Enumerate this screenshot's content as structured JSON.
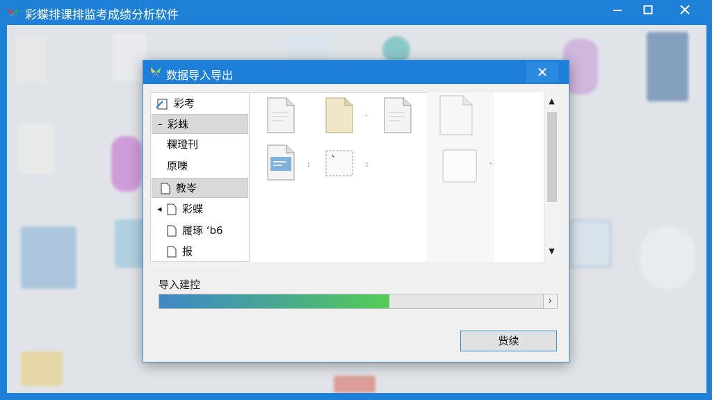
{
  "app": {
    "title": "彩蝶排课排监考成绩分析软件",
    "window_controls": {
      "minimize": "—",
      "maximize": "☐",
      "close": "✕"
    }
  },
  "dialog": {
    "title": "数据导入导出",
    "close": "✕",
    "tree": [
      {
        "label": "彩考",
        "prefix": "",
        "icon": "edit-document-icon",
        "selected": false
      },
      {
        "label": "彩蛛",
        "prefix": "–",
        "icon": "",
        "selected": true
      },
      {
        "label": "粿璒刊",
        "prefix": "",
        "icon": "",
        "selected": false
      },
      {
        "label": "原嚛",
        "prefix": "",
        "icon": "",
        "selected": false
      },
      {
        "label": "教岺",
        "prefix": "",
        "icon": "document-icon",
        "selected": true
      },
      {
        "label": "彩蝶",
        "prefix": "◂",
        "icon": "document-icon",
        "selected": false
      },
      {
        "label": "履琢 ‘b6",
        "prefix": "",
        "icon": "document-icon",
        "selected": false
      },
      {
        "label": "报",
        "prefix": "",
        "icon": "document-icon",
        "selected": false
      }
    ],
    "files": {
      "sep1": "·",
      "sep2": ":",
      "sep3": ":",
      "sep4": "·"
    },
    "scroll": {
      "up": "▲",
      "down": "▼"
    },
    "progress": {
      "label": "导入建控",
      "value_fraction": 0.6,
      "arrow": "›"
    },
    "ok_button": "赀续"
  },
  "colors": {
    "titlebar": "#1e80d6",
    "dialog_titlebar": "#1e7fd8",
    "progress_start": "#3f88c8",
    "progress_end": "#55cc55"
  }
}
